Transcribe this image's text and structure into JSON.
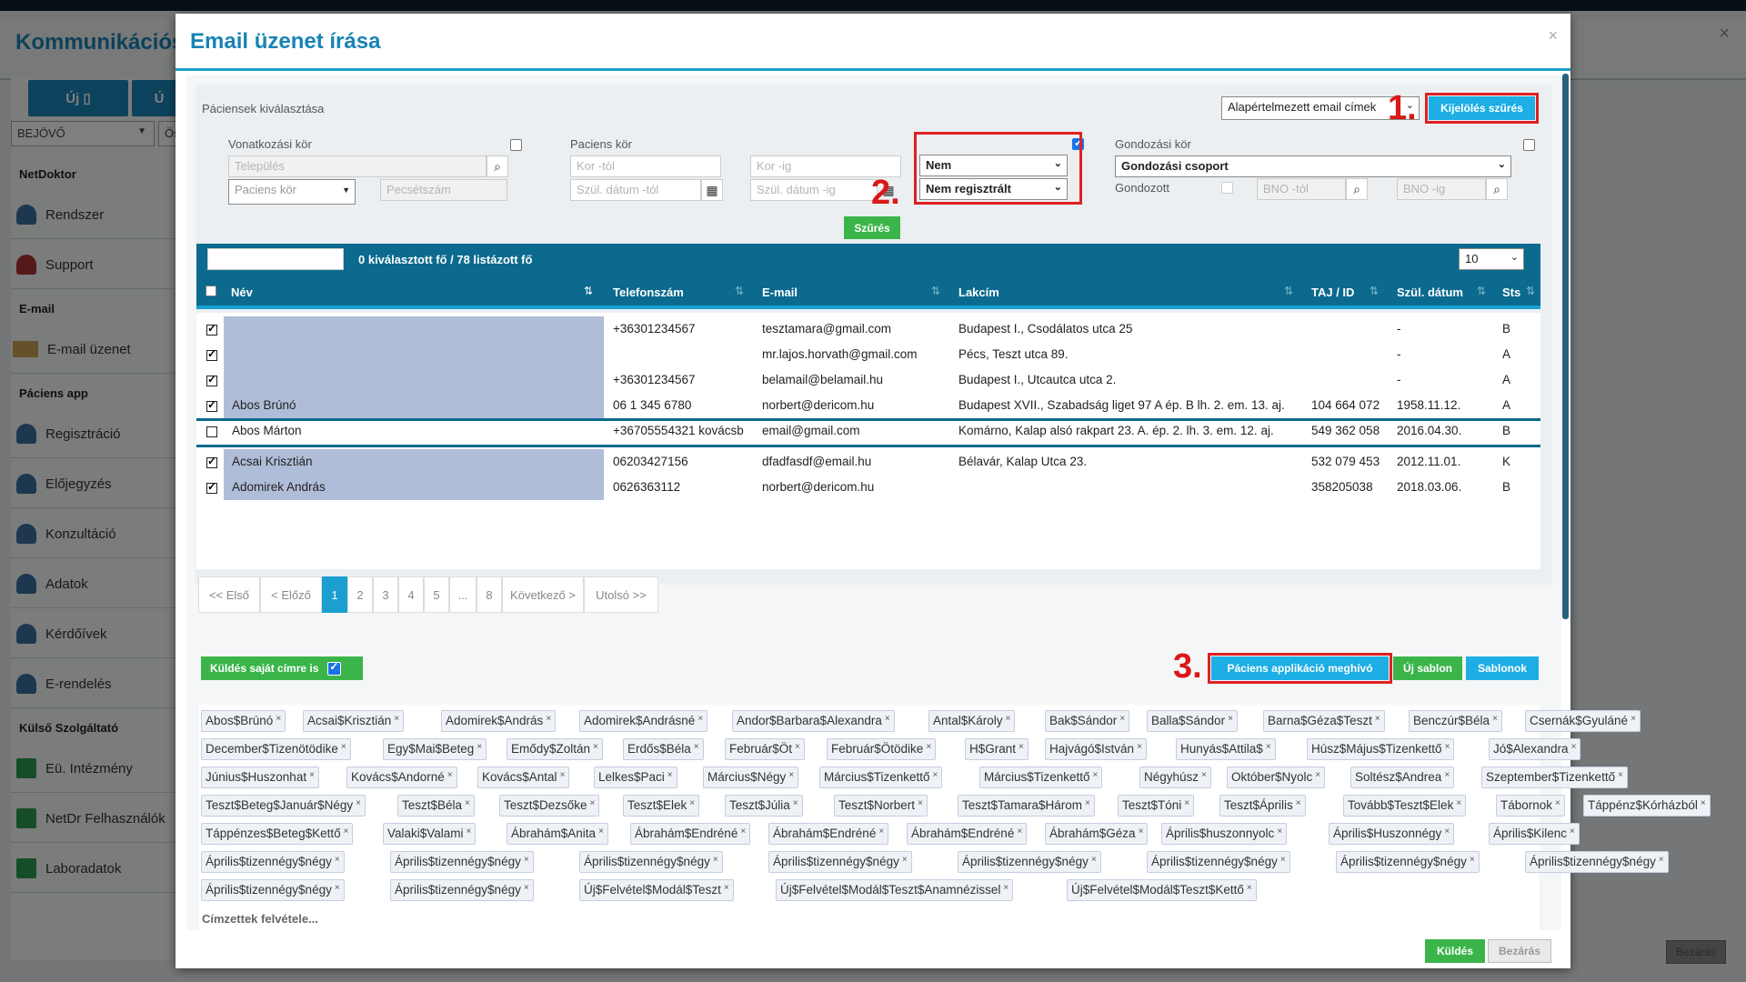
{
  "background": {
    "title": "Kommunikációs",
    "new_button": "Új",
    "second_button": "Ú",
    "mailbox_select": "BEJÖVŐ",
    "os_label": "Ös",
    "close_label": "Bezárás",
    "sidebar": [
      {
        "type": "head",
        "label": "NetDoktor"
      },
      {
        "type": "item",
        "label": "Rendszer",
        "icon": "person-icon"
      },
      {
        "type": "item",
        "label": "Support",
        "icon": "support-icon"
      },
      {
        "type": "head",
        "label": "E-mail"
      },
      {
        "type": "item",
        "label": "E-mail üzenet",
        "icon": "envelope-icon"
      },
      {
        "type": "head",
        "label": "Páciens app"
      },
      {
        "type": "item",
        "label": "Regisztráció",
        "icon": "person-icon"
      },
      {
        "type": "item",
        "label": "Előjegyzés",
        "icon": "person-icon"
      },
      {
        "type": "item",
        "label": "Konzultáció",
        "icon": "person-icon"
      },
      {
        "type": "item",
        "label": "Adatok",
        "icon": "person-icon"
      },
      {
        "type": "item",
        "label": "Kérdőívek",
        "icon": "person-icon"
      },
      {
        "type": "item",
        "label": "E-rendelés",
        "icon": "person-icon"
      },
      {
        "type": "head",
        "label": "Külső Szolgáltató"
      },
      {
        "type": "item",
        "label": "Eü. Intézmény",
        "icon": "plus-icon"
      },
      {
        "type": "item",
        "label": "NetDr Felhasználók",
        "icon": "plus-icon"
      },
      {
        "type": "item",
        "label": "Laboradatok",
        "icon": "plus-icon"
      }
    ]
  },
  "modal": {
    "title": "Email üzenet írása",
    "close": "×",
    "section_label": "Páciensek kiválasztása",
    "default_email_select": "Alapértelmezett email címek",
    "selection_filter_button": "Kijelölés szűrés",
    "annotations": {
      "one": "1.",
      "two": "2.",
      "three": "3."
    },
    "filters": {
      "ref_label": "Vonatkozási kör",
      "city_placeholder": "Település",
      "patient_circle_select": "Paciens kör",
      "stamp_placeholder": "Pecsétszám",
      "patient_label": "Paciens kör",
      "age_from": "Kor -tól",
      "age_to": "Kor -ig",
      "birth_from": "Szül. dátum -tól",
      "birth_to": "Szül. dátum -ig",
      "nem_select": "Nem",
      "registered_select": "Nem regisztrált",
      "care_label": "Gondozási kör",
      "care_group_select": "Gondozási csoport",
      "cared_label": "Gondozott",
      "bno_from": "BNO -tól",
      "bno_to": "BNO -ig",
      "filter_button": "Szűrés"
    },
    "table": {
      "summary": "0 kiválasztott fő / 78 listázott fő",
      "page_size": "10",
      "headers": {
        "name": "Név",
        "phone": "Telefonszám",
        "email": "E-mail",
        "address": "Lakcím",
        "taj": "TAJ / ID",
        "birth": "Szül. dátum",
        "status": "Sts"
      },
      "rows": [
        {
          "checked": true,
          "name": "",
          "phone": "+36301234567",
          "email": "tesztamara@gmail.com",
          "address": "Budapest I., Csodálatos utca 25",
          "taj": "",
          "birth": "-",
          "status": "B"
        },
        {
          "checked": true,
          "name": "",
          "phone": "",
          "email": "mr.lajos.horvath@gmail.com",
          "address": "Pécs, Teszt utca 89.",
          "taj": "",
          "birth": "-",
          "status": "A"
        },
        {
          "checked": true,
          "name": "",
          "phone": "+36301234567",
          "email": "belamail@belamail.hu",
          "address": "Budapest I., Utcautca utca 2.",
          "taj": "",
          "birth": "-",
          "status": "A"
        },
        {
          "checked": true,
          "name": "Abos Brúnó",
          "phone": "06 1 345 6780",
          "email": "norbert@dericom.hu",
          "address": "Budapest XVII., Szabadság liget 97 A ép. B lh. 2. em. 13. aj.",
          "taj": "104 664 072",
          "birth": "1958.11.12.",
          "status": "A"
        },
        {
          "checked": false,
          "name": "Abos Márton",
          "phone": "+36705554321 kovácsb",
          "email": "email@gmail.com",
          "address": "Komárno, Kalap alsó rakpart 23. A. ép. 2. lh. 3. em. 12. aj.",
          "taj": "549 362 058",
          "birth": "2016.04.30.",
          "status": "B"
        },
        {
          "checked": true,
          "name": "Acsai Krisztián",
          "phone": "06203427156",
          "email": "dfadfasdf@email.hu",
          "address": "Bélavár, Kalap Utca 23.",
          "taj": "532 079 453",
          "birth": "2012.11.01.",
          "status": "K"
        },
        {
          "checked": true,
          "name": "Adomirek András",
          "phone": "0626363112",
          "email": "norbert@dericom.hu",
          "address": "",
          "taj": "358205038",
          "birth": "2018.03.06.",
          "status": "B"
        }
      ]
    },
    "pagination": [
      "<< Első",
      "< Előző",
      "1",
      "2",
      "3",
      "4",
      "5",
      "...",
      "8",
      "Következő >",
      "Utolsó >>"
    ],
    "send_own_label": "Küldés saját címre is",
    "patient_app_invite_button": "Páciens applikáció meghívó",
    "new_template_button": "Új sablon",
    "templates_button": "Sablonok",
    "tags": [
      [
        "Abos$Brúnó",
        "Acsai$Krisztián",
        "Adomirek$András",
        "Adomirek$Andrásné",
        "Andor$Barbara$Alexandra",
        "Antal$Károly",
        "Bak$Sándor",
        "Balla$Sándor",
        "Barna$Géza$Teszt",
        "Benczúr$Béla",
        "Csernák$Gyuláné"
      ],
      [
        "December$Tizenötödike",
        "Egy$Mai$Beteg",
        "Emődy$Zoltán",
        "Erdős$Béla",
        "Február$Öt",
        "Február$Ötödike",
        "H$Grant",
        "Hajvágó$István",
        "Hunyás$Attila$",
        "Húsz$Május$Tizenkettő",
        "Jó$Alexandra"
      ],
      [
        "Június$Huszonhat",
        "Kovács$Andorné",
        "Kovács$Antal",
        "Lelkes$Paci",
        "Március$Négy",
        "Március$Tizenkettő",
        "Március$Tizenkettő",
        "Négyhúsz",
        "Október$Nyolc",
        "Soltész$Andrea",
        "Szeptember$Tizenkettő"
      ],
      [
        "Teszt$Beteg$Január$Négy",
        "Teszt$Béla",
        "Teszt$Dezsőke",
        "Teszt$Elek",
        "Teszt$Júlia",
        "Teszt$Norbert",
        "Teszt$Tamara$Három",
        "Teszt$Tóni",
        "Teszt$Április",
        "Tovább$Teszt$Elek",
        "Tábornok",
        "Táppénz$Kórházból"
      ],
      [
        "Táppénzes$Beteg$Kettő",
        "Valaki$Valami",
        "Ábrahám$Anita",
        "Ábrahám$Endréné",
        "Ábrahám$Endréné",
        "Ábrahám$Endréné",
        "Ábrahám$Géza",
        "Április$huszonnyolc",
        "Április$Huszonnégy",
        "Április$Kilenc"
      ],
      [
        "Április$tizennégy$négy",
        "Április$tizennégy$négy",
        "Április$tizennégy$négy",
        "Április$tizennégy$négy",
        "Április$tizennégy$négy",
        "Április$tizennégy$négy",
        "Április$tizennégy$négy",
        "Április$tizennégy$négy"
      ],
      [
        "Április$tizennégy$négy",
        "Április$tizennégy$négy",
        "Új$Felvétel$Modál$Teszt",
        "Új$Felvétel$Modál$Teszt$Anamnézissel",
        "Új$Felvétel$Modál$Teszt$Kettő"
      ]
    ],
    "add_recipients": "Címzettek felvétele...",
    "send_button": "Küldés",
    "close_button": "Bezárás"
  }
}
